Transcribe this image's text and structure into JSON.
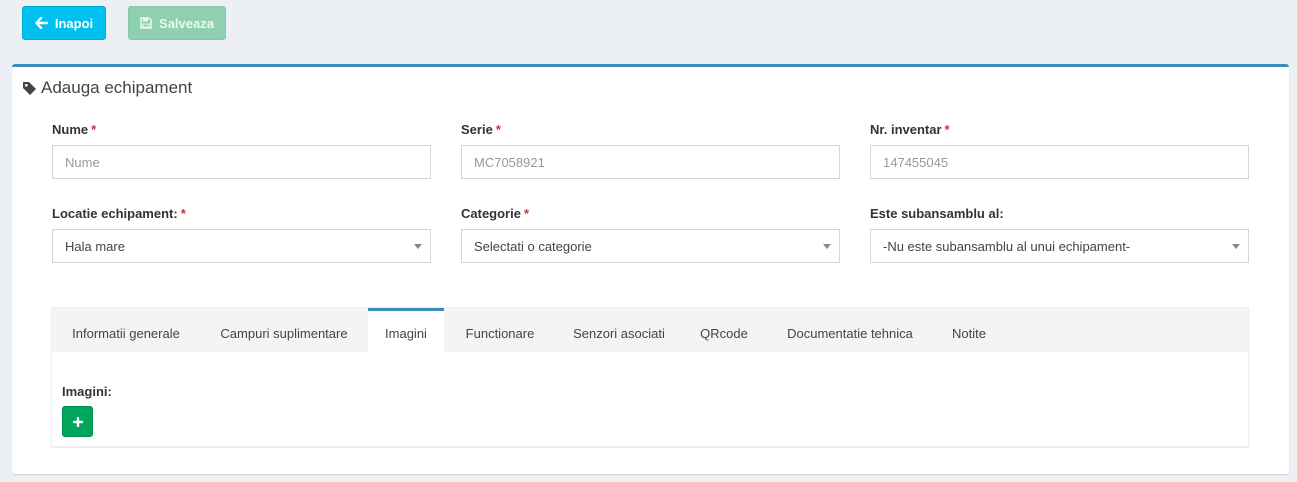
{
  "toolbar": {
    "back_label": "Inapoi",
    "save_label": "Salveaza"
  },
  "form": {
    "title": "Adauga echipament",
    "required_mark": "*",
    "fields": {
      "nume": {
        "label": "Nume",
        "placeholder": "Nume",
        "value": ""
      },
      "serie": {
        "label": "Serie",
        "placeholder": "MC7058921",
        "value": ""
      },
      "inventar": {
        "label": "Nr. inventar",
        "placeholder": "147455045",
        "value": ""
      },
      "locatie": {
        "label": "Locatie echipament:",
        "selected": "Hala mare"
      },
      "categorie": {
        "label": "Categorie",
        "selected": "Selectati o categorie"
      },
      "subansamblu": {
        "label": "Este subansamblu al:",
        "selected": "-Nu este subansamblu al unui echipament-"
      }
    }
  },
  "tabs": {
    "items": [
      {
        "label": "Informatii generale"
      },
      {
        "label": "Campuri suplimentare"
      },
      {
        "label": "Imagini"
      },
      {
        "label": "Functionare"
      },
      {
        "label": "Senzori asociati"
      },
      {
        "label": "QRcode"
      },
      {
        "label": "Documentatie tehnica"
      },
      {
        "label": "Notite"
      }
    ],
    "active": "Imagini"
  },
  "imagini": {
    "label": "Imagini:"
  },
  "colors": {
    "back_button": "#00c0ef",
    "save_button": "#8fd0b0",
    "add_button": "#00a65a",
    "box_accent": "#3c8dbc",
    "required": "#dd2c2c"
  }
}
